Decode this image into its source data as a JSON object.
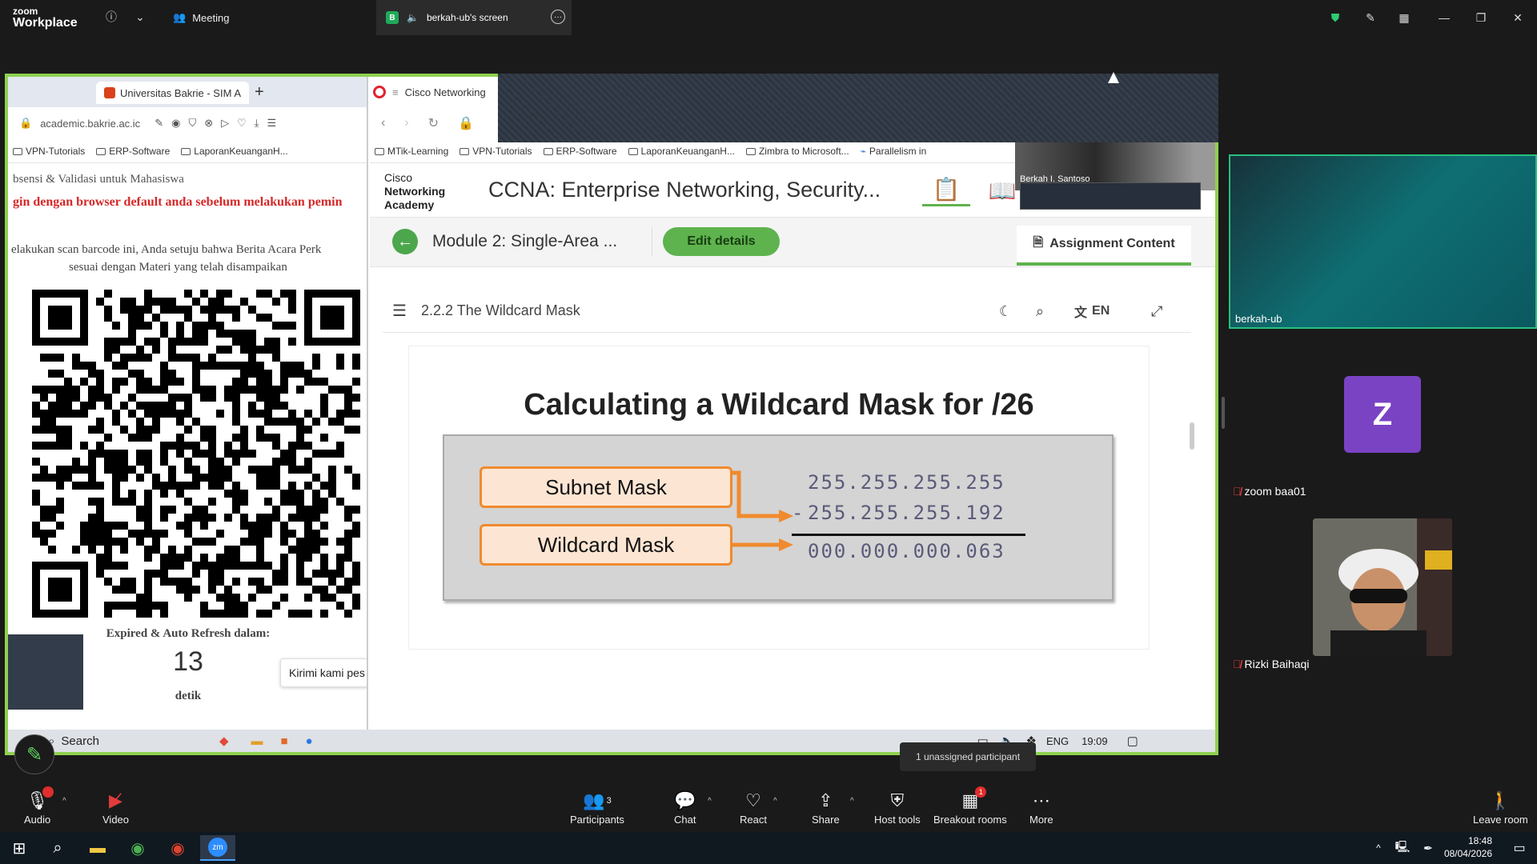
{
  "topbar": {
    "logo_line1": "zoom",
    "logo_line2": "Workplace",
    "meeting_label": "Meeting",
    "screen_tab_badge": "B",
    "screen_tab_label": "berkah-ub's screen"
  },
  "shared_left": {
    "tab_title": "Universitas Bakrie - SIM A",
    "address": "academic.bakrie.ac.ic",
    "bookmarks": [
      "VPN-Tutorials",
      "ERP-Software",
      "LaporanKeuanganH..."
    ],
    "heading_partial": "bsensi & Validasi untuk Mahasiswa",
    "red_notice": "gin dengan browser default anda sebelum melakukan pemin",
    "scan_line1": "elakukan scan barcode ini, Anda setuju bahwa Berita Acara Perk",
    "scan_line2": "sesuai dengan Materi yang telah disampaikan",
    "expired_label": "Expired & Auto Refresh dalam:",
    "countdown": "13",
    "countdown_unit": "detik",
    "chat_prompt": "Kirimi kami pes"
  },
  "shared_right": {
    "tab_title": "Cisco Networking",
    "bookmarks": [
      "MTik-Learning",
      "VPN-Tutorials",
      "ERP-Software",
      "LaporanKeuanganH...",
      "Zimbra to Microsoft...",
      "Parallelism in"
    ],
    "cisco_logo": [
      "Cisco",
      "Networking",
      "Academy"
    ],
    "course_title": "CCNA: Enterprise Networking, Security...",
    "module_title": "Module 2: Single-Area ...",
    "edit_button": "Edit details",
    "assignment_tab": "Assignment Content",
    "topic_title": "2.2.2 The Wildcard Mask",
    "language": "EN",
    "slide": {
      "title": "Calculating a Wildcard Mask for /26",
      "box1": "Subnet Mask",
      "box2": "Wildcard Mask",
      "ip1": "255.255.255.255",
      "minus": "-",
      "ip2": "255.255.255.192",
      "result": "000.000.000.063"
    }
  },
  "inner_taskbar": {
    "search": "Search",
    "lang": "ENG",
    "time": "19:09"
  },
  "self_video_name": "Berkah I. Santoso",
  "tooltip": "1 unassigned participant",
  "participants": [
    {
      "name": "berkah-ub",
      "muted": false
    },
    {
      "name": "zoom baa01",
      "initial": "Z",
      "muted": true
    },
    {
      "name": "Rizki Baihaqi",
      "muted": true
    }
  ],
  "toolbar": {
    "audio": "Audio",
    "video": "Video",
    "participants": "Participants",
    "participants_count": "3",
    "chat": "Chat",
    "react": "React",
    "share": "Share",
    "host_tools": "Host tools",
    "breakout_rooms": "Breakout rooms",
    "breakout_badge": "1",
    "more": "More",
    "leave": "Leave room"
  },
  "windows_taskbar": {
    "time": "18:48",
    "date": "08/04/2026"
  },
  "colors": {
    "share_border": "#8fd14f",
    "active_speaker": "#27c07e",
    "avatar_z": "#7a43c4",
    "cisco_green": "#5eb34e",
    "mask_orange": "#f08a2e",
    "notice_red": "#d62828"
  }
}
